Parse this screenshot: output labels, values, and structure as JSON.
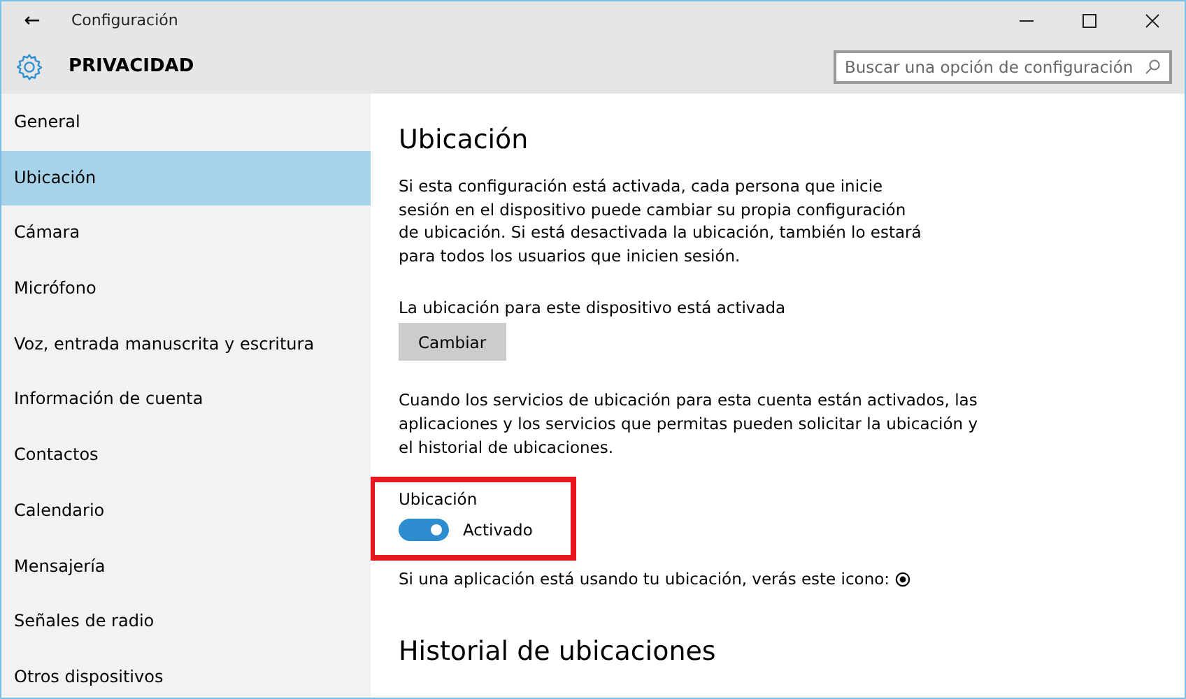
{
  "window": {
    "title": "Configuración",
    "back": "←"
  },
  "header": {
    "title": "PRIVACIDAD",
    "search": {
      "placeholder": "Buscar una opción de configuración"
    }
  },
  "sidebar": {
    "items": [
      {
        "label": "General",
        "selected": false
      },
      {
        "label": "Ubicación",
        "selected": true
      },
      {
        "label": "Cámara",
        "selected": false
      },
      {
        "label": "Micrófono",
        "selected": false
      },
      {
        "label": "Voz, entrada manuscrita y escritura",
        "selected": false
      },
      {
        "label": "Información de cuenta",
        "selected": false
      },
      {
        "label": "Contactos",
        "selected": false
      },
      {
        "label": "Calendario",
        "selected": false
      },
      {
        "label": "Mensajería",
        "selected": false
      },
      {
        "label": "Señales de radio",
        "selected": false
      },
      {
        "label": "Otros dispositivos",
        "selected": false
      }
    ]
  },
  "content": {
    "heading": "Ubicación",
    "intro": "Si esta configuración está activada, cada persona que inicie sesión en el dispositivo puede cambiar su propia configuración de ubicación. Si está desactivada la ubicación, también lo estará para todos los usuarios que inicien sesión.",
    "device_status": "La ubicación para este dispositivo está activada",
    "change_button": "Cambiar",
    "services_text": "Cuando los servicios de ubicación para esta cuenta están activados, las aplicaciones y los servicios que permitas pueden solicitar la ubicación y el historial de ubicaciones.",
    "toggle": {
      "label": "Ubicación",
      "on": true,
      "state_text": "Activado",
      "highlighted": true
    },
    "icon_note": "Si una aplicación está usando tu ubicación, verás este icono:",
    "history_heading": "Historial de ubicaciones"
  }
}
